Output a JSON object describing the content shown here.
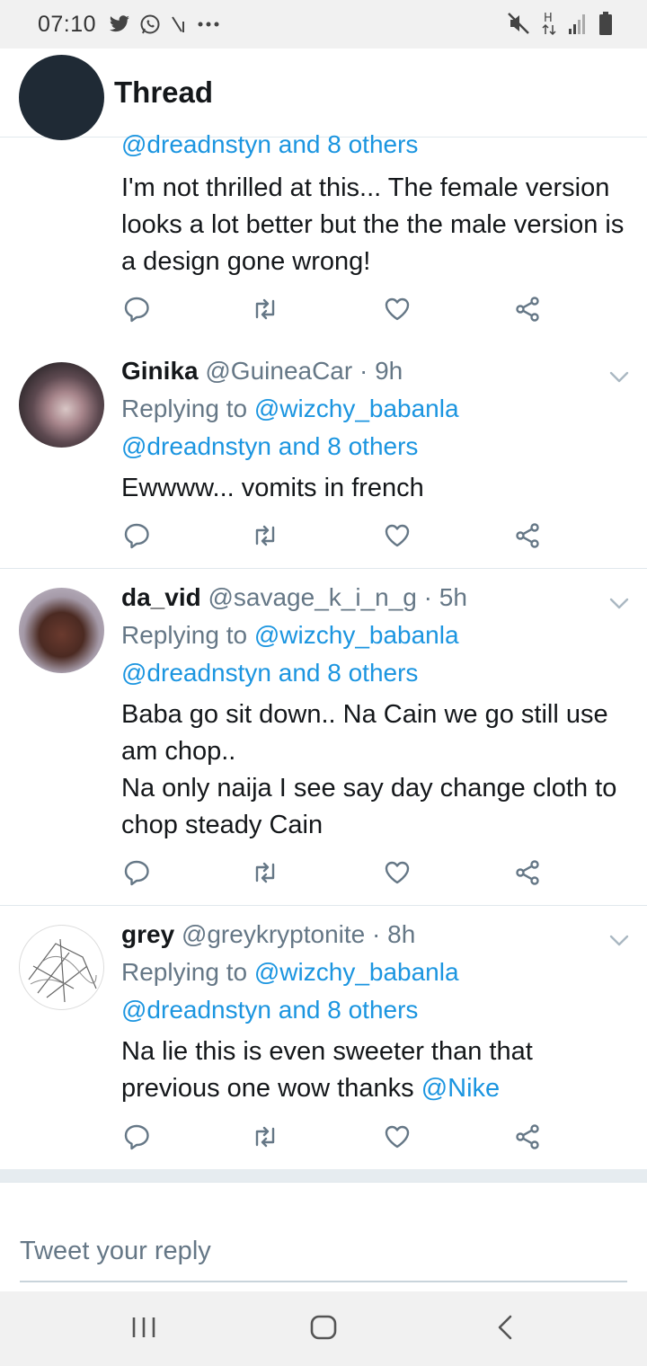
{
  "status_bar": {
    "time": "07:10",
    "left_icons": [
      "twitter-icon",
      "whatsapp-icon",
      "signal-slash-icon",
      "more-dots-icon"
    ],
    "right_icons": [
      "mute-icon",
      "h-data-icon",
      "signal-bars-icon",
      "battery-icon"
    ]
  },
  "header": {
    "title": "Thread",
    "back_icon": "arrow-left-icon",
    "accent": "#1b95e0"
  },
  "tweets": [
    {
      "partial": true,
      "mentions_line": "@dreadnstyn and 8 others",
      "body": "I'm not thrilled at this... The female version looks a lot better but the the male version is a design gone wrong!"
    },
    {
      "name": "Ginika",
      "handle": "@GuineaCar",
      "time": "· 9h",
      "replying_prefix": "Replying to ",
      "replying_to": "@wizchy_babanla",
      "mentions_line": "@dreadnstyn and 8 others",
      "body": "Ewwww... vomits in french"
    },
    {
      "name": "da_vid",
      "handle": "@savage_k_i_n_g",
      "time": "· 5h",
      "replying_prefix": "Replying to ",
      "replying_to": "@wizchy_babanla",
      "mentions_line": "@dreadnstyn and 8 others",
      "body_line1": "Baba go sit down.. Na Cain we go still use am chop..",
      "body_line2": "Na only naija I see say day change cloth to chop steady Cain"
    },
    {
      "name": "grey",
      "handle": "@greykryptonite",
      "time": "· 8h",
      "replying_prefix": "Replying to ",
      "replying_to": "@wizchy_babanla",
      "mentions_line": "@dreadnstyn and 8 others",
      "body": "Na lie this is even sweeter than that previous one wow thanks ",
      "body_link": "@Nike"
    }
  ],
  "composer": {
    "placeholder": "Tweet your reply"
  },
  "nav_bar": {
    "icons": [
      "recent-apps-icon",
      "home-icon",
      "back-icon"
    ]
  }
}
